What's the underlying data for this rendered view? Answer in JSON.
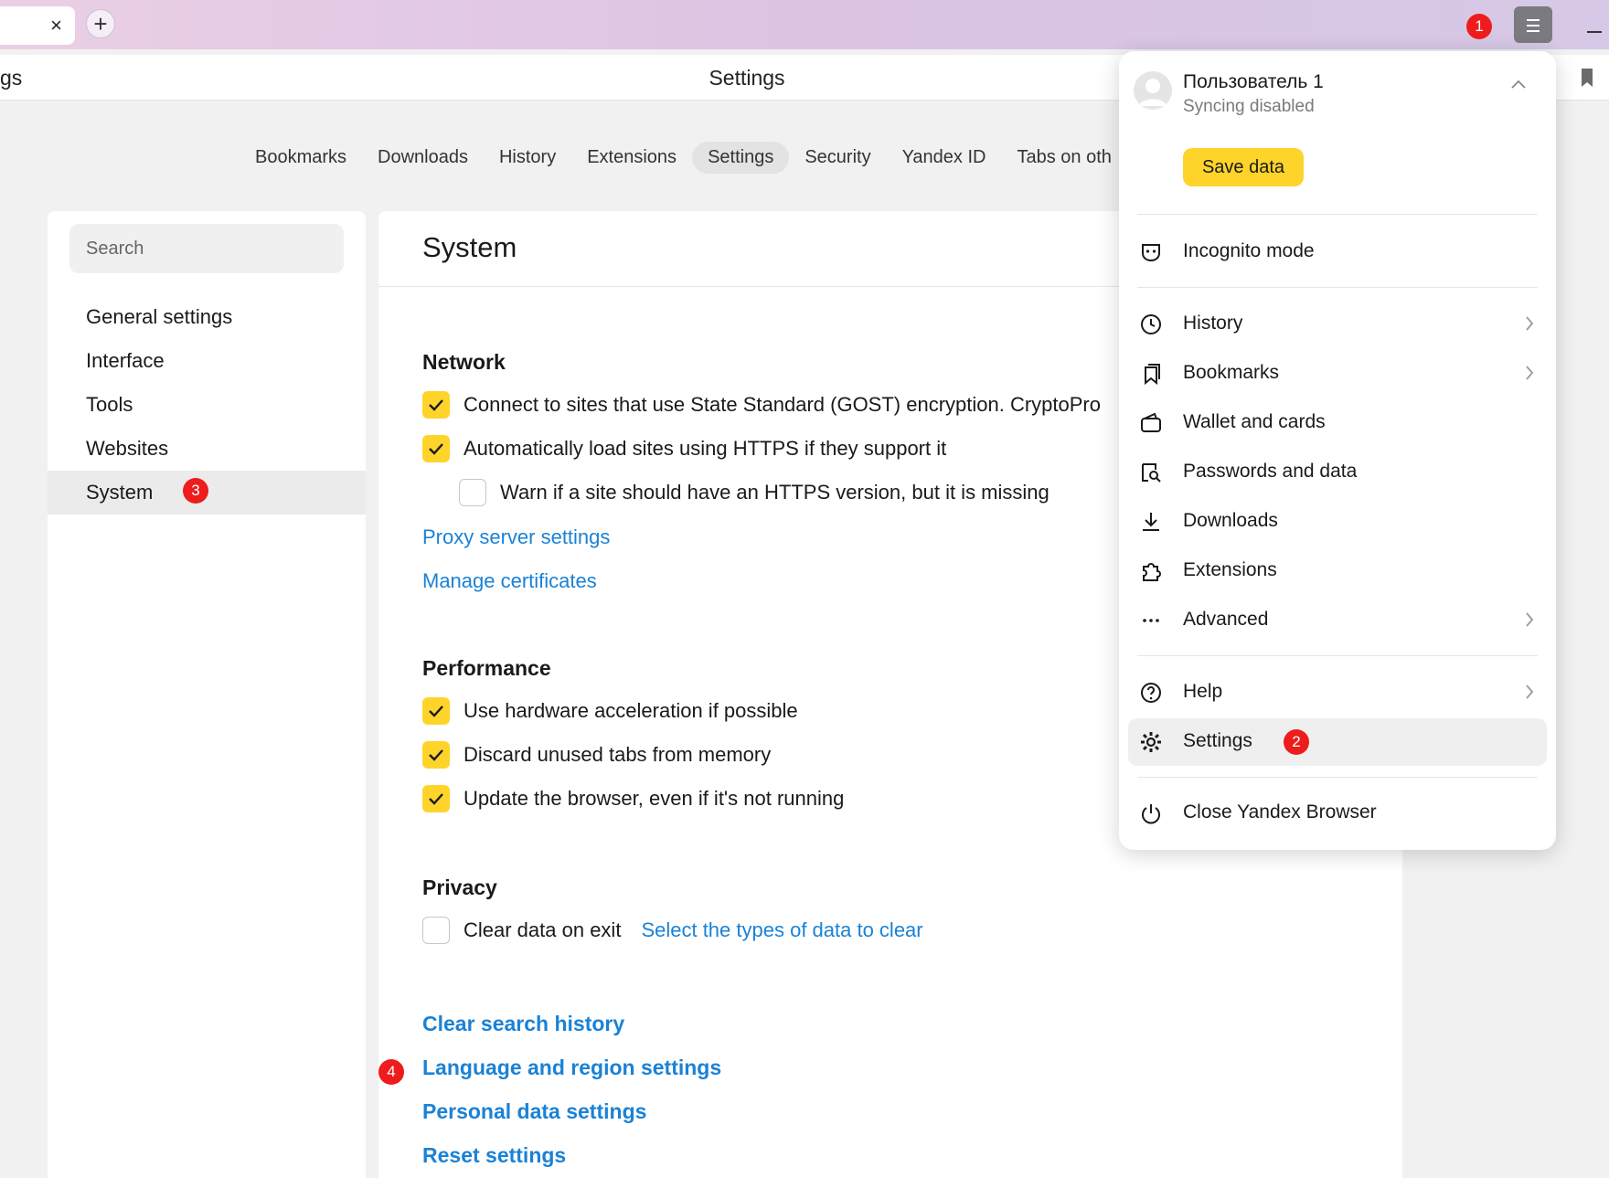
{
  "tabstrip": {
    "close_glyph": "×",
    "new_tab_glyph": "+"
  },
  "addressbar": {
    "left_fragment": "gs",
    "title": "Settings"
  },
  "topnav": {
    "items": [
      {
        "label": "Bookmarks"
      },
      {
        "label": "Downloads"
      },
      {
        "label": "History"
      },
      {
        "label": "Extensions"
      },
      {
        "label": "Settings",
        "active": true
      },
      {
        "label": "Security"
      },
      {
        "label": "Yandex ID"
      },
      {
        "label": "Tabs on oth"
      }
    ]
  },
  "sidebar": {
    "search_placeholder": "Search",
    "items": [
      {
        "label": "General settings"
      },
      {
        "label": "Interface"
      },
      {
        "label": "Tools"
      },
      {
        "label": "Websites"
      },
      {
        "label": "System",
        "active": true
      }
    ]
  },
  "main": {
    "title": "System",
    "network": {
      "heading": "Network",
      "opt1": "Connect to sites that use State Standard (GOST) encryption. CryptoPro",
      "opt2": "Automatically load sites using HTTPS if they support it",
      "opt3": "Warn if a site should have an HTTPS version, but it is missing",
      "proxy_link": "Proxy server settings",
      "certs_link": "Manage certificates"
    },
    "performance": {
      "heading": "Performance",
      "opt1": "Use hardware acceleration if possible",
      "opt2": "Discard unused tabs from memory",
      "opt3": "Update the browser, even if it's not running"
    },
    "privacy": {
      "heading": "Privacy",
      "opt1": "Clear data on exit",
      "select_link": "Select the types of data to clear"
    },
    "links": {
      "clear_search": "Clear search history",
      "language": "Language and region settings",
      "personal": "Personal data settings",
      "reset": "Reset settings"
    }
  },
  "menu": {
    "user_name": "Пользователь 1",
    "user_status": "Syncing disabled",
    "save_button": "Save data",
    "incognito": "Incognito mode",
    "history": "History",
    "bookmarks": "Bookmarks",
    "wallet": "Wallet and cards",
    "passwords": "Passwords and data",
    "downloads": "Downloads",
    "extensions": "Extensions",
    "advanced": "Advanced",
    "help": "Help",
    "settings": "Settings",
    "close": "Close Yandex Browser"
  },
  "annotations": {
    "b1": "1",
    "b2": "2",
    "b3": "3",
    "b4": "4"
  },
  "colors": {
    "accent_yellow": "#fed42b",
    "link_blue": "#1a82d6",
    "badge_red": "#ee1c1c"
  }
}
